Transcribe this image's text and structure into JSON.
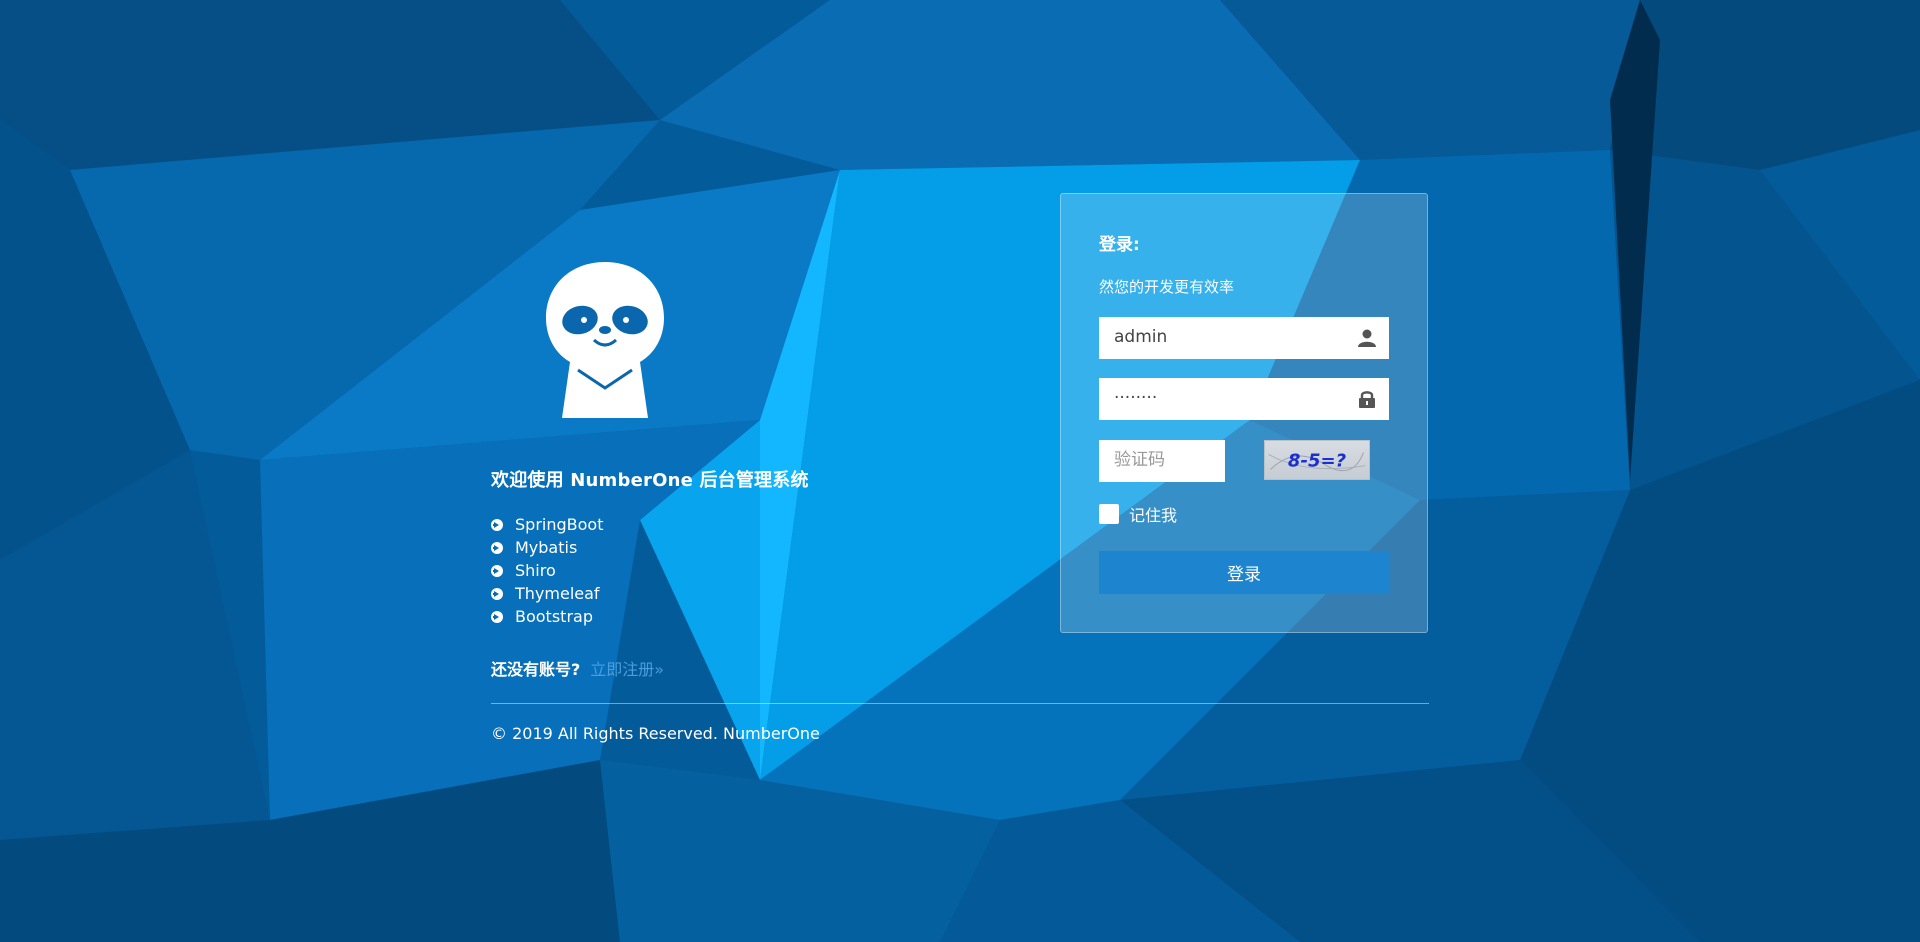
{
  "intro": {
    "welcome": "欢迎使用 NumberOne 后台管理系统",
    "features": [
      "SpringBoot",
      "Mybatis",
      "Shiro",
      "Thymeleaf",
      "Bootstrap"
    ],
    "register_question": "还没有账号?",
    "register_link": "立即注册»"
  },
  "footer": {
    "copyright": "© 2019 All Rights Reserved. NumberOne"
  },
  "login": {
    "title": "登录:",
    "subtitle": "然您的开发更有效率",
    "username_value": "admin",
    "password_value": "········",
    "captcha_placeholder": "验证码",
    "captcha_text": "8-5=?",
    "remember_label": "记住我",
    "submit_label": "登录"
  },
  "icons": {
    "mascot": "sloth-logo",
    "feature_bullet": "arrow-circle-right-icon",
    "username": "user-icon",
    "password": "lock-icon"
  },
  "colors": {
    "background": "#035b9a",
    "accent": "#1d84d0",
    "link": "#4b9ddd"
  }
}
